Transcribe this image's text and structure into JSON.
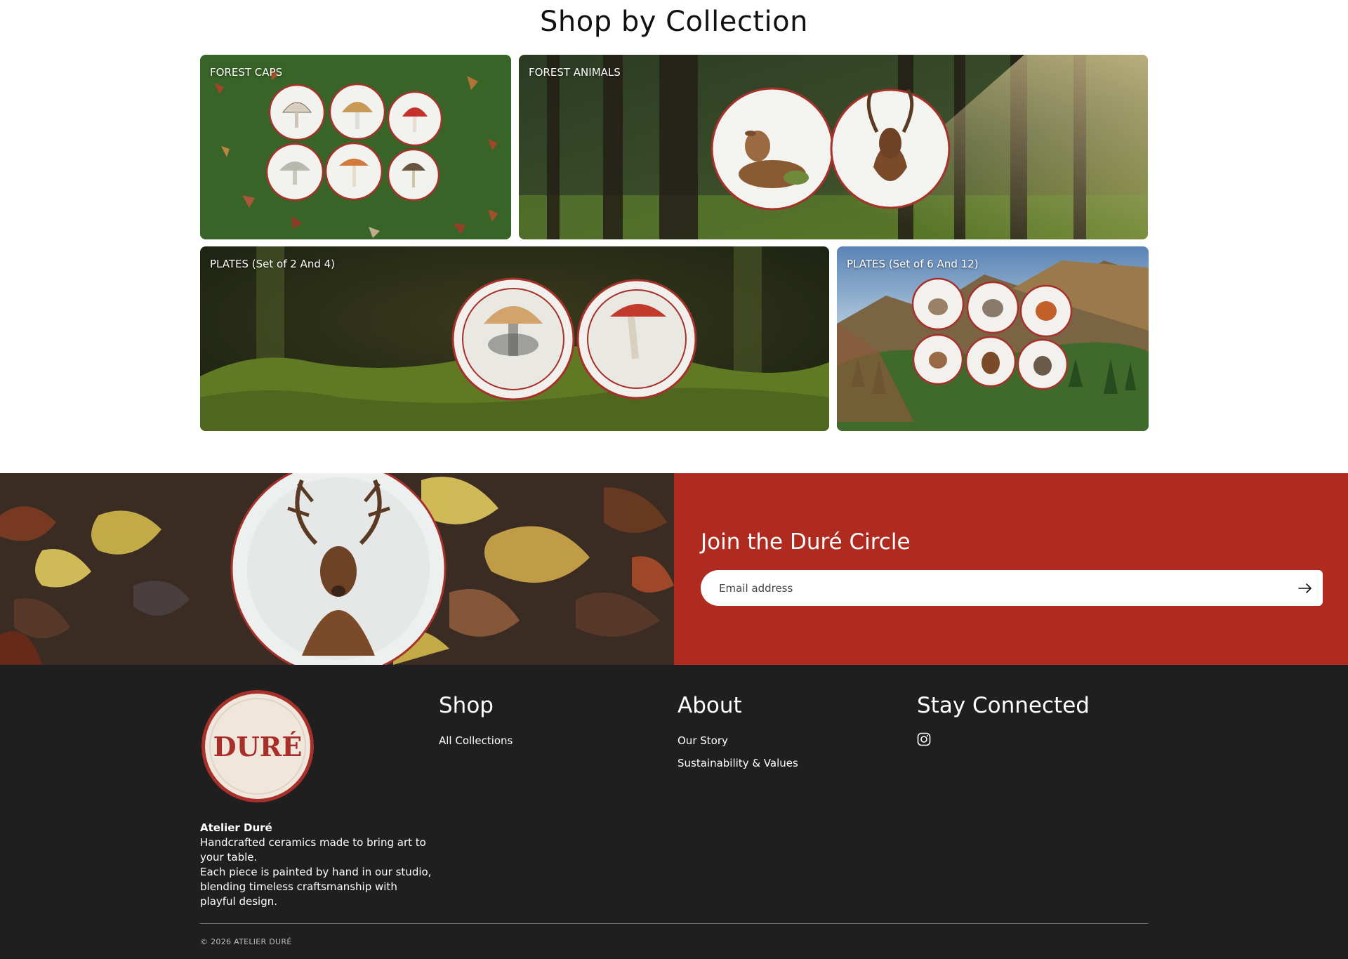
{
  "collections": {
    "title": "Shop by Collection",
    "tiles": [
      {
        "label": "FOREST CAPS"
      },
      {
        "label": "FOREST ANIMALS"
      },
      {
        "label": "PLATES (Set of 2 And 4)"
      },
      {
        "label": "PLATES (Set of 6 And 12)"
      }
    ]
  },
  "newsletter": {
    "heading": "Join the Duré Circle",
    "email_placeholder": "Email address",
    "submit_icon": "arrow-right-icon",
    "panel_color": "#af2a1f"
  },
  "footer": {
    "logo_text": "DURÉ",
    "brand_name": "Atelier Duré",
    "brand_lines": [
      "Handcrafted ceramics made to bring art to",
      "your table.",
      "Each piece is painted by hand in our studio,",
      "blending timeless craftsmanship with",
      "playful design."
    ],
    "shop": {
      "heading": "Shop",
      "links": [
        "All Collections"
      ]
    },
    "about": {
      "heading": "About",
      "links": [
        "Our Story",
        "Sustainability & Values"
      ]
    },
    "connect": {
      "heading": "Stay Connected",
      "icon": "instagram-icon"
    },
    "copyright": "© 2026 ATELIER DURÉ",
    "background": "#1f1f1f"
  }
}
